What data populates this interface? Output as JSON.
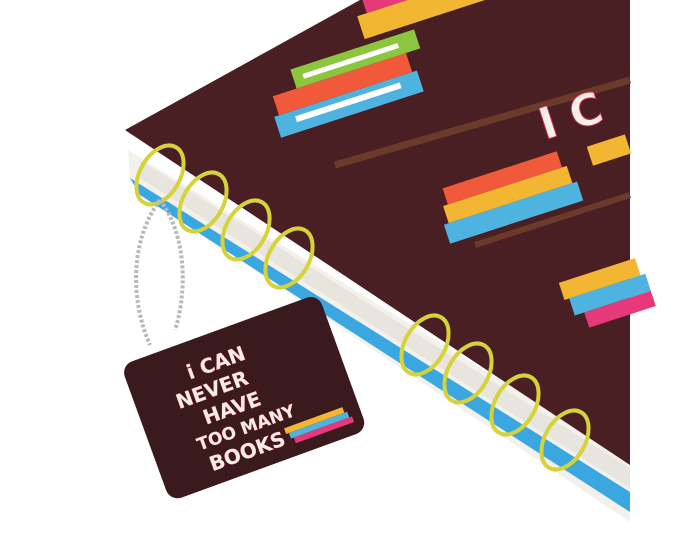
{
  "scene": "Spiral notebook with bookshelf cover and a book-themed tag on a ball chain",
  "cover": {
    "partial_title": "I C"
  },
  "tag": {
    "lines": [
      "i CAN",
      "NEVER",
      "HAVE",
      "TOO MANY",
      "BOOKS"
    ]
  },
  "colors": {
    "cover": "#4a1f24",
    "page_edge_blue": "#3aa7e0",
    "ring": "#d6d23a",
    "accent_pink": "#d8264a"
  }
}
